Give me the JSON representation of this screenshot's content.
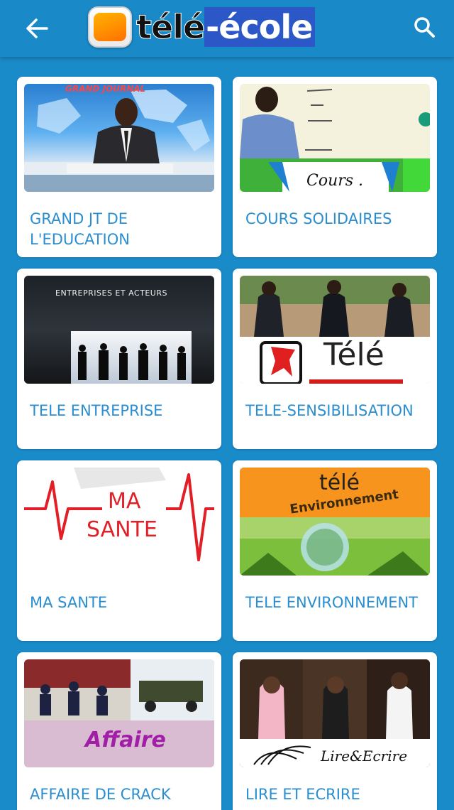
{
  "header": {
    "logo_part1": "télé",
    "logo_part2": "-école",
    "back_icon": "arrow-left-icon",
    "search_icon": "search-icon"
  },
  "colors": {
    "background": "#1a8bc9",
    "header": "#1989c8",
    "title": "#2a8ed0",
    "card": "#ffffff"
  },
  "programs": [
    {
      "title": "GRAND JT DE L'EDUCATION",
      "thumb_text": "GRAND JOURNAL"
    },
    {
      "title": "COURS SOLIDAIRES",
      "thumb_text": "Cours ."
    },
    {
      "title": "TELE ENTREPRISE",
      "thumb_text": "ENTREPRISES ET ACTEURS"
    },
    {
      "title": "TELE-SENSIBILISATION",
      "thumb_text": "Télé"
    },
    {
      "title": "MA SANTE",
      "thumb_text_1": "MA",
      "thumb_text_2": "SANTE"
    },
    {
      "title": "TELE ENVIRONNEMENT",
      "thumb_text_1": "télé",
      "thumb_text_2": "Environnement"
    },
    {
      "title": "AFFAIRE DE CRACK",
      "thumb_text": "Affaire"
    },
    {
      "title": "LIRE ET ECRIRE",
      "thumb_text": "Lire&Ecrire"
    }
  ]
}
